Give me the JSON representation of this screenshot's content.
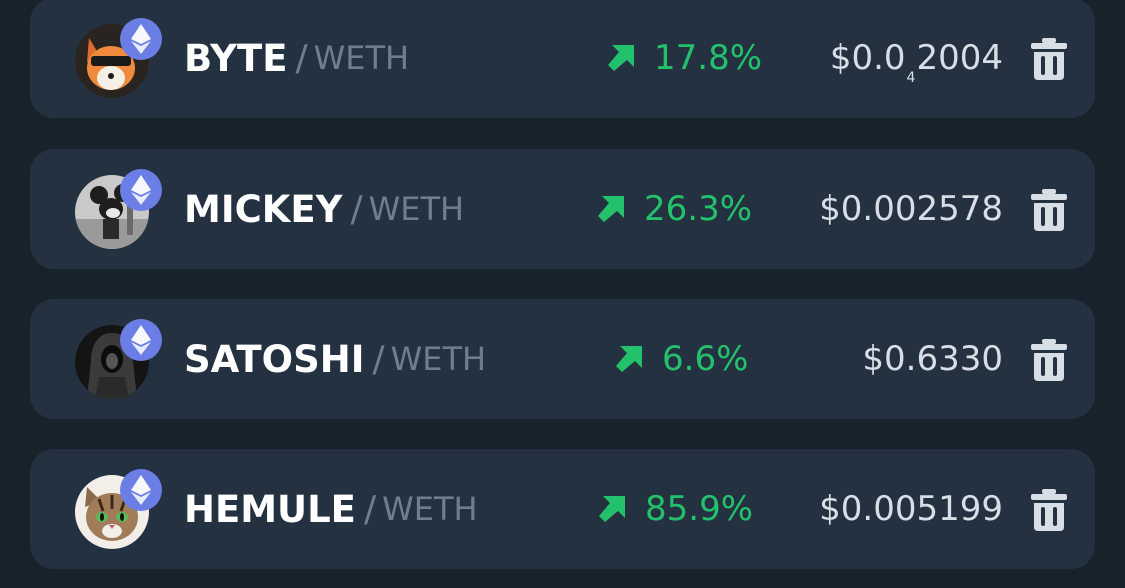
{
  "colors": {
    "background": "#17222b",
    "card": "#243140",
    "positive": "#23c16b",
    "badge": "#6b7ee6",
    "quote_text": "#6d7e90",
    "price_text": "#d8dee6"
  },
  "tokens": [
    {
      "symbol": "BYTE",
      "slash": "/",
      "quote": "WETH",
      "change_icon": "arrow-up-right-icon",
      "change": "17.8%",
      "price_prefix": "$0.0",
      "price_subscript": "4",
      "price_suffix": "2004",
      "avatar_icon": "fox-avatar-icon",
      "chain_icon": "ethereum-icon",
      "delete_icon": "trash-icon"
    },
    {
      "symbol": "MICKEY",
      "slash": "/",
      "quote": "WETH",
      "change_icon": "arrow-up-right-icon",
      "change": "26.3%",
      "price": "$0.002578",
      "avatar_icon": "steamboat-mickey-avatar-icon",
      "chain_icon": "ethereum-icon",
      "delete_icon": "trash-icon"
    },
    {
      "symbol": "SATOSHI",
      "slash": "/",
      "quote": "WETH",
      "change_icon": "arrow-up-right-icon",
      "change": "6.6%",
      "price": "$0.6330",
      "avatar_icon": "hooded-figure-avatar-icon",
      "chain_icon": "ethereum-icon",
      "delete_icon": "trash-icon"
    },
    {
      "symbol": "HEMULE",
      "slash": "/",
      "quote": "WETH",
      "change_icon": "arrow-up-right-icon",
      "change": "85.9%",
      "price": "$0.005199",
      "avatar_icon": "tabby-cat-avatar-icon",
      "chain_icon": "ethereum-icon",
      "delete_icon": "trash-icon"
    }
  ]
}
